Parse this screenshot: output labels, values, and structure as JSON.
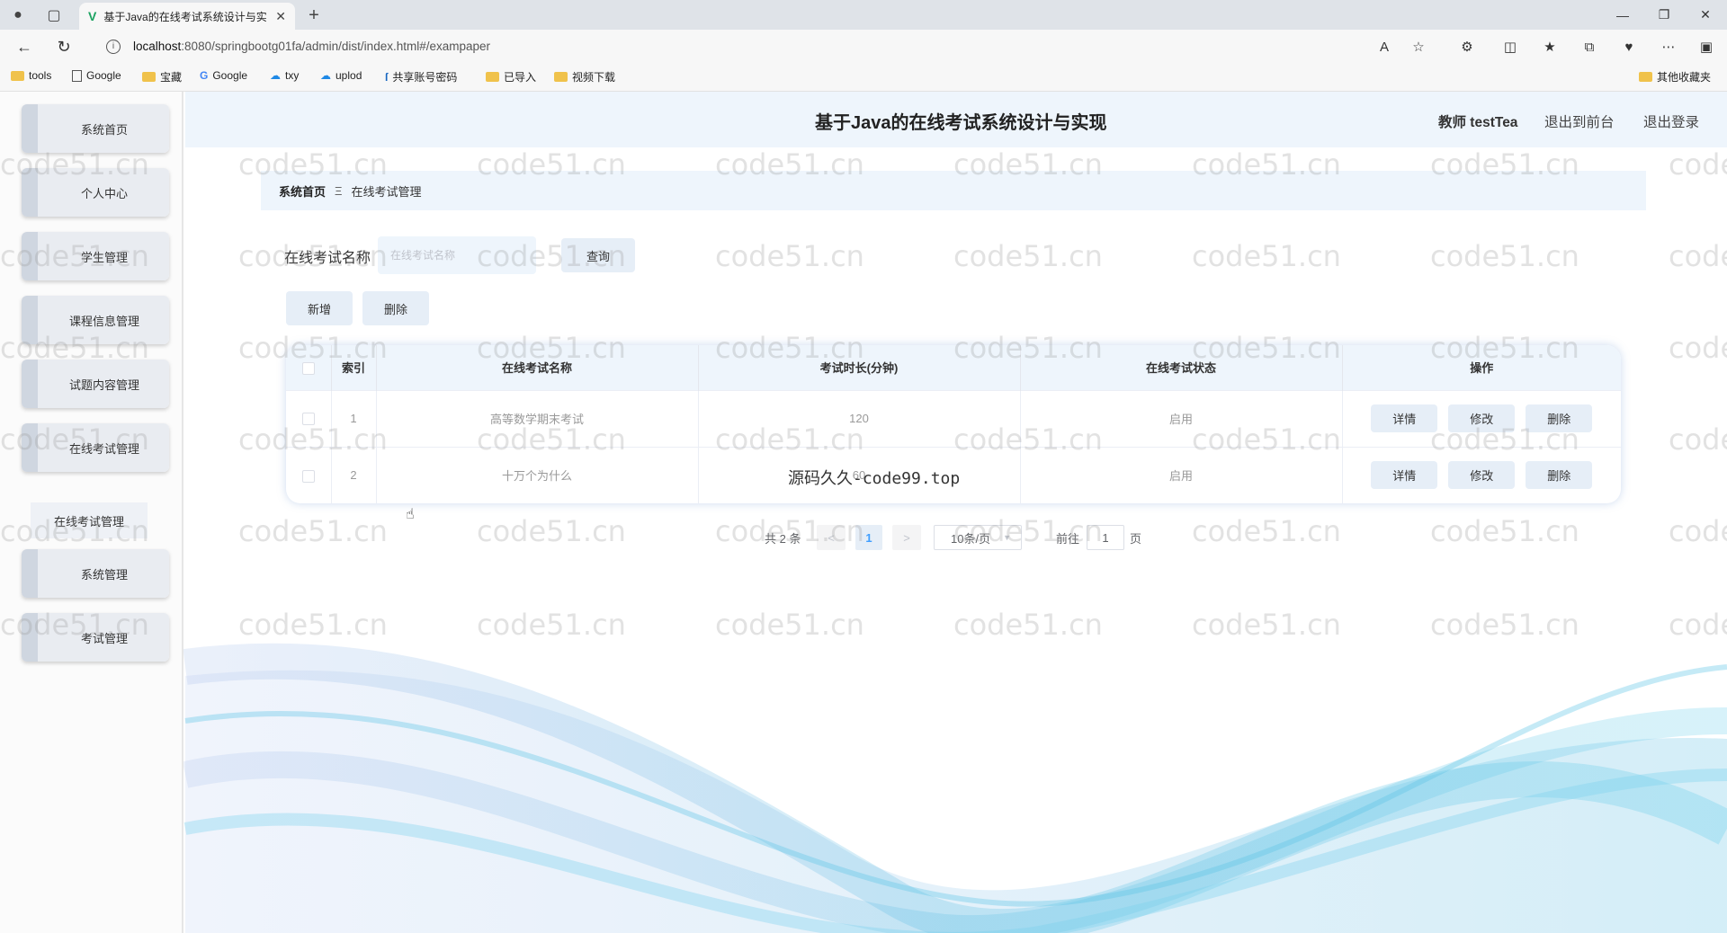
{
  "browser": {
    "tab_title": "基于Java的在线考试系统设计与实",
    "url_host": "localhost",
    "url_rest": ":8080/springbootg01fa/admin/dist/index.html#/exampaper",
    "bookmarks": [
      "tools",
      "Google",
      "宝藏",
      "Google",
      "txy",
      "uplod",
      "共享账号密码",
      "已导入",
      "视频下载"
    ],
    "other_bookmarks": "其他收藏夹"
  },
  "sidebar": {
    "items": [
      "系统首页",
      "个人中心",
      "学生管理",
      "课程信息管理",
      "试题内容管理",
      "在线考试管理",
      "系统管理",
      "考试管理"
    ],
    "submenu_item": "在线考试管理"
  },
  "header": {
    "title": "基于Java的在线考试系统设计与实现",
    "user": "教师 testTea",
    "back_link": "退出到前台",
    "logout_link": "退出登录"
  },
  "breadcrumb": {
    "home": "系统首页",
    "separator": "Ξ",
    "current": "在线考试管理"
  },
  "search": {
    "label": "在线考试名称",
    "placeholder": "在线考试名称",
    "button": "查询"
  },
  "actions": {
    "add": "新增",
    "delete": "删除"
  },
  "table": {
    "columns": [
      "索引",
      "在线考试名称",
      "考试时长(分钟)",
      "在线考试状态",
      "操作"
    ],
    "rows": [
      {
        "index": "1",
        "name": "高等数学期末考试",
        "duration": "120",
        "status": "启用"
      },
      {
        "index": "2",
        "name": "十万个为什么",
        "duration": "60",
        "status": "启用"
      }
    ],
    "row_actions": {
      "detail": "详情",
      "edit": "修改",
      "delete": "删除"
    }
  },
  "pagination": {
    "total": "共 2 条",
    "prev": "<",
    "current_page": "1",
    "next": ">",
    "page_size": "10条/页",
    "goto_label": "前往",
    "goto_value": "1",
    "page_suffix": "页"
  },
  "watermarks": {
    "text": "code51.cn",
    "overlay": "源码久久-code99.top"
  },
  "colors": {
    "header_bg": "#eef5fc",
    "button_bg": "#e6eef7",
    "wave": "#4ab8e0"
  }
}
